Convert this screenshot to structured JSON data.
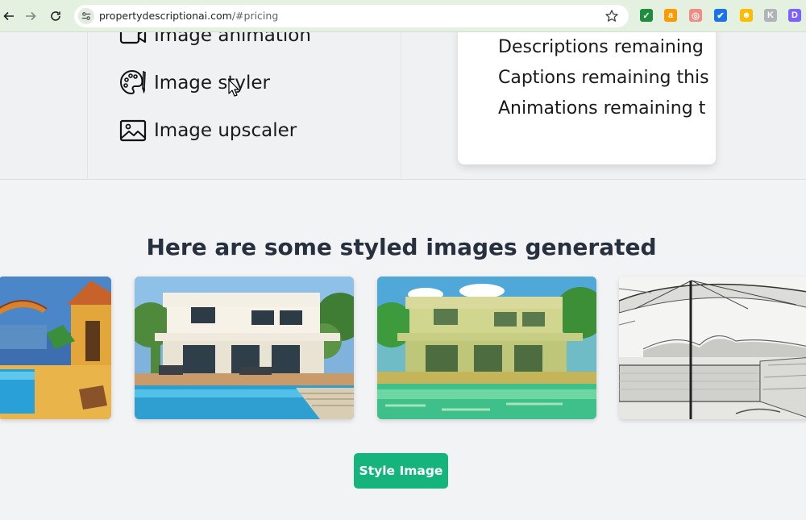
{
  "browser": {
    "url_host": "propertydescriptionai.com",
    "url_path": "/#pricing",
    "extensions": [
      {
        "name": "check-extension-icon",
        "color": "#1e8e3e",
        "glyph": "✓"
      },
      {
        "name": "amazon-extension-icon",
        "color": "#ff9900",
        "glyph": "a"
      },
      {
        "name": "camera-extension-icon",
        "color": "#f28b82",
        "glyph": "◎"
      },
      {
        "name": "shield-extension-icon",
        "color": "#1a73e8",
        "glyph": "✔"
      },
      {
        "name": "emoji-extension-icon",
        "color": "#fbbc04",
        "glyph": "☻"
      },
      {
        "name": "k-extension-icon",
        "color": "#b0b3b8",
        "glyph": "K"
      },
      {
        "name": "d-extension-icon",
        "color": "#7b61ff",
        "glyph": "D"
      }
    ]
  },
  "features": {
    "animation": "Image animation",
    "styler": "Image styler",
    "upscaler": "Image upscaler"
  },
  "usage": {
    "descriptions": "Descriptions remaining",
    "captions": "Captions remaining this",
    "animations": "Animations remaining t"
  },
  "gallery": {
    "title": "Here are some styled images generated",
    "images": [
      {
        "name": "styled-image-impressionist",
        "style": "impressionist painting"
      },
      {
        "name": "styled-image-painted-villa",
        "style": "painted villa"
      },
      {
        "name": "styled-image-green-tint",
        "style": "green tinted villa"
      },
      {
        "name": "styled-image-pencil-sketch",
        "style": "pencil sketch"
      }
    ]
  },
  "cta": {
    "style_image_label": "Style Image"
  },
  "colors": {
    "accent": "#14b47c",
    "browser_bar": "#e4f0e0"
  }
}
